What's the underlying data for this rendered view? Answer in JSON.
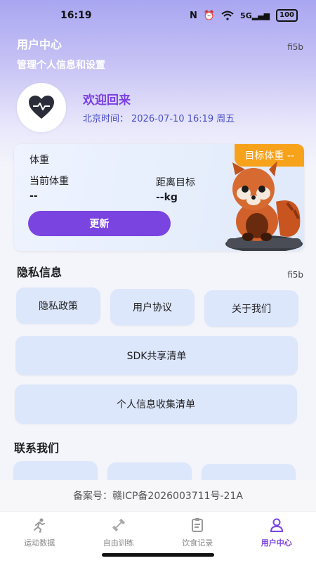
{
  "status_bar": {
    "time": "16:19",
    "battery": "100",
    "network": "5G"
  },
  "header": {
    "title": "用户中心",
    "subtitle": "管理个人信息和设置",
    "version": "fi5b"
  },
  "profile": {
    "welcome": "欢迎回来",
    "time_label": "北京时间：",
    "datetime": "2026-07-10 16:19",
    "weekday": "周五"
  },
  "weight_card": {
    "title": "体重",
    "target_badge": "目标体重 --",
    "current_label": "当前体重",
    "current_value": "--",
    "distance_label": "距离目标",
    "distance_value": "--kg",
    "update_button": "更新"
  },
  "privacy": {
    "title": "隐私信息",
    "version": "fi5b",
    "items": [
      "隐私政策",
      "用户协议",
      "关于我们",
      "SDK共享清单",
      "个人信息收集清单"
    ]
  },
  "contact": {
    "title": "联系我们"
  },
  "filing": "备案号：赣ICP备2026003711号-21A",
  "tabs": [
    {
      "label": "运动数据",
      "icon": "running-icon"
    },
    {
      "label": "自由训练",
      "icon": "dumbbell-icon"
    },
    {
      "label": "饮食记录",
      "icon": "clipboard-icon"
    },
    {
      "label": "用户中心",
      "icon": "user-icon",
      "active": true
    }
  ],
  "colors": {
    "accent": "#7a44e0",
    "badge": "#f7a21b",
    "pill": "#dde7fb"
  }
}
